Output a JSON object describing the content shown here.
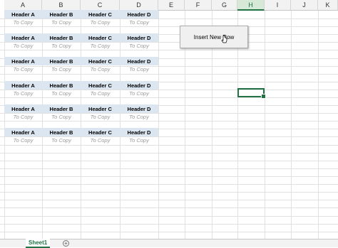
{
  "columns": [
    "A",
    "B",
    "C",
    "D",
    "E",
    "F",
    "G",
    "H",
    "I",
    "J",
    "K"
  ],
  "active_column": "H",
  "block": {
    "headers": [
      "Header A",
      "Header B",
      "Header C",
      "Header D"
    ],
    "copies": [
      "To Copy",
      "To Copy",
      "To Copy",
      "To Copy"
    ]
  },
  "button": {
    "label": "Insert New Row"
  },
  "sheet_tab": {
    "label": "Sheet1"
  },
  "add_sheet": {
    "label": "+"
  },
  "colors": {
    "header_fill": "#dce6f1",
    "accent": "#217346",
    "copy_text": "#9a9a9a"
  }
}
